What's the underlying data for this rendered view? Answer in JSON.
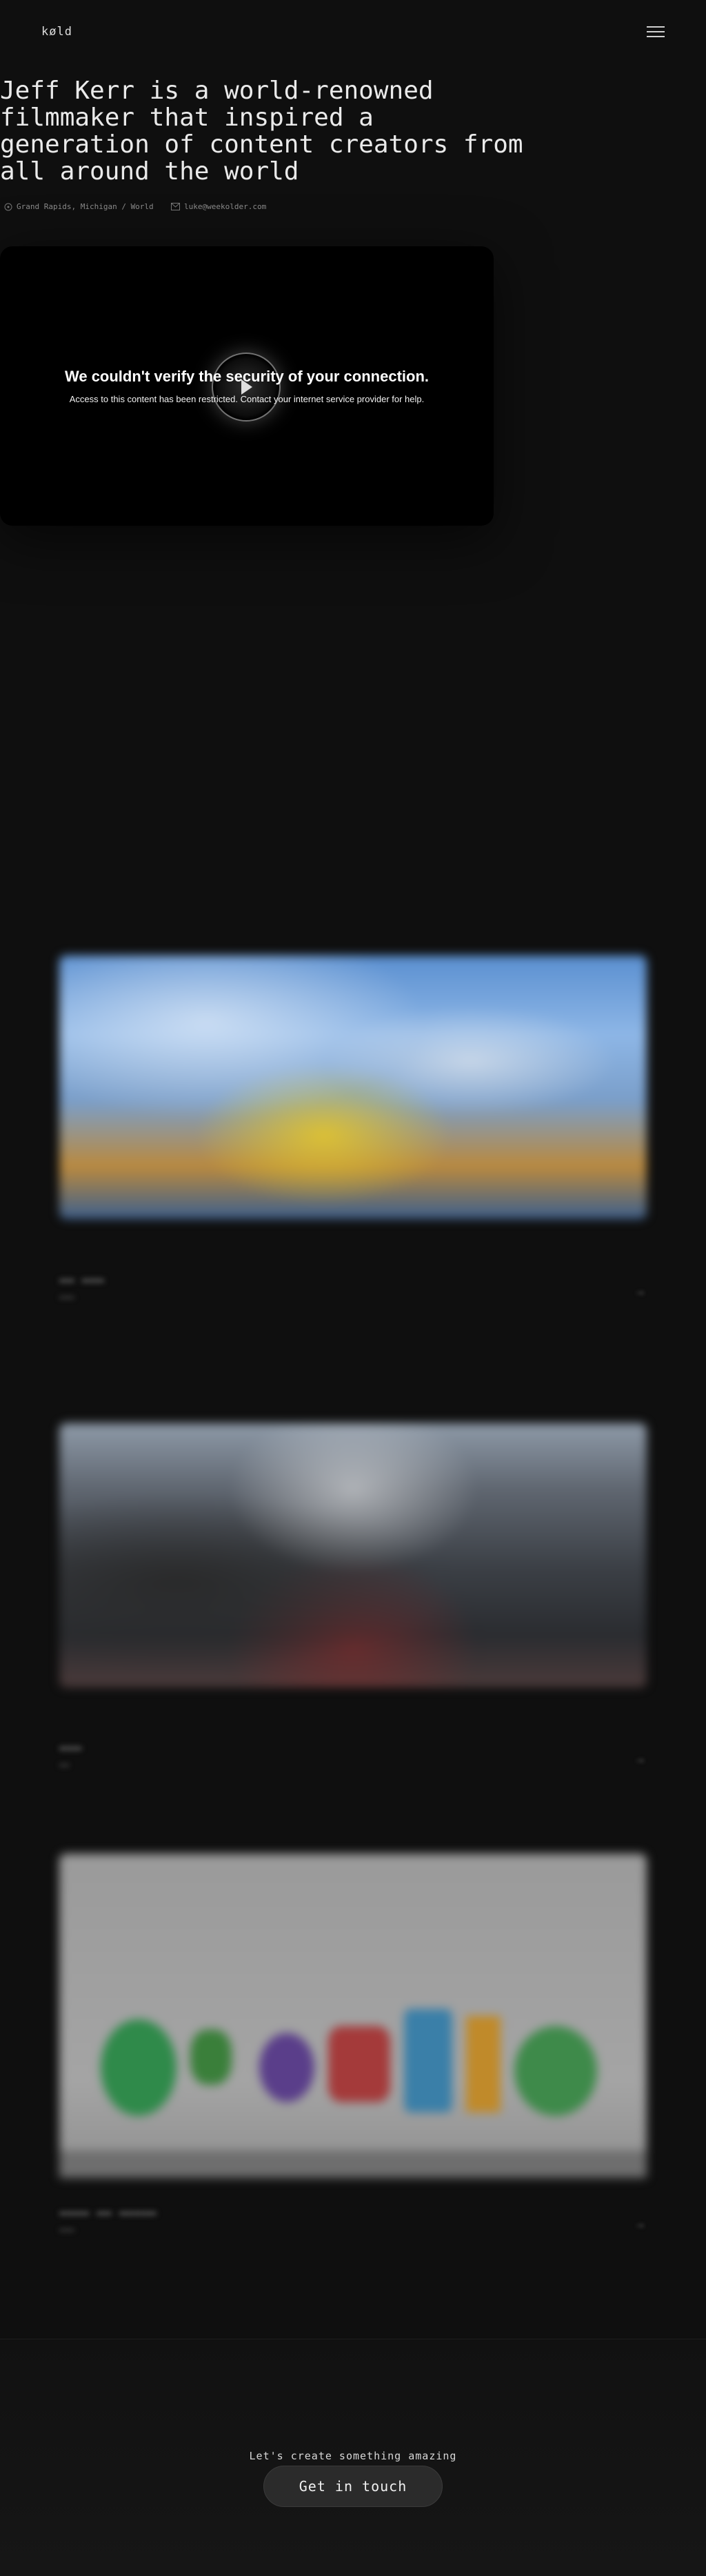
{
  "header": {
    "logo": "køld",
    "menu_icon": "hamburger-icon"
  },
  "hero": {
    "headline": "Jeff Kerr is a world-renowned filmmaker that inspired a generation of content creators from all around the world",
    "location": "Grand Rapids, Michigan / World",
    "email": "luke@weekolder.com",
    "location_icon": "map-pin-icon",
    "email_icon": "mail-icon"
  },
  "video": {
    "error_title": "We couldn't verify the security of your connection.",
    "error_message": "Access to this content has been restricted. Contact your internet service provider for help.",
    "play_icon": "play-icon"
  },
  "footer": {
    "cta_label": "Let's create something amazing",
    "cta_button": "Get in touch"
  }
}
